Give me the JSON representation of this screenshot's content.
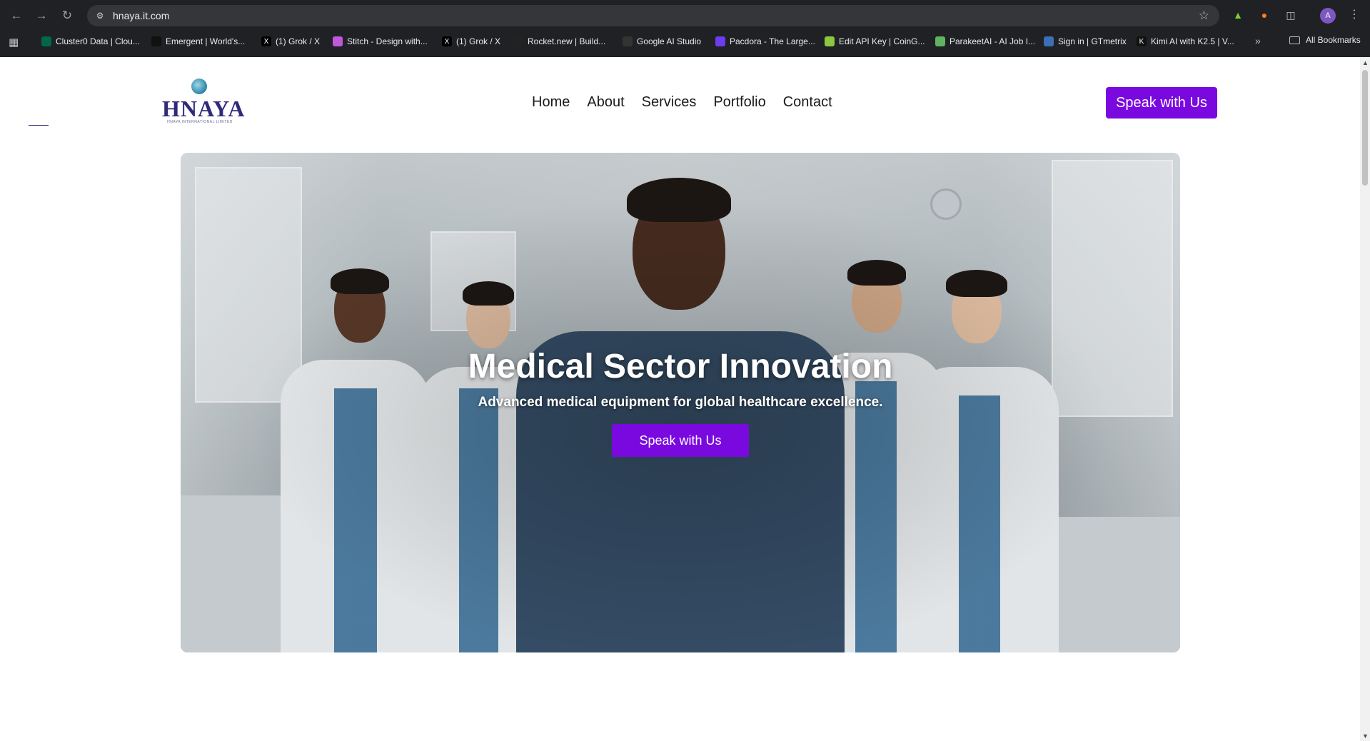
{
  "browser": {
    "url": "hnaya.it.com",
    "avatar_letter": "A",
    "bookmarks": [
      {
        "label": "Cluster0 Data | Clou...",
        "color": "#00684a"
      },
      {
        "label": "Emergent | World's...",
        "color": "#111111"
      },
      {
        "label": "(1) Grok / X",
        "color": "#000000"
      },
      {
        "label": "Stitch - Design with...",
        "color": "#c158dc"
      },
      {
        "label": "(1) Grok / X",
        "color": "#000000"
      },
      {
        "label": "Rocket.new | Build...",
        "color": "#222222"
      },
      {
        "label": "Google AI Studio",
        "color": "#333333"
      },
      {
        "label": "Pacdora - The Large...",
        "color": "#6c3cf0"
      },
      {
        "label": "Edit API Key | CoinG...",
        "color": "#8dc63f"
      },
      {
        "label": "ParakeetAI - AI Job I...",
        "color": "#5fb35f"
      },
      {
        "label": "Sign in | GTmetrix",
        "color": "#3b6fb6"
      },
      {
        "label": "Kimi AI with K2.5 | V...",
        "color": "#111111"
      }
    ],
    "more_glyph": "»",
    "all_bookmarks": "All Bookmarks"
  },
  "site": {
    "logo_text": "HNAYA",
    "logo_sub": "HNAYA INTERNATIONAL LIMITED",
    "nav": [
      "Home",
      "About",
      "Services",
      "Portfolio",
      "Contact"
    ],
    "cta_top": "Speak with Us",
    "accent": "#7a09e0"
  },
  "hero": {
    "title": "Medical Sector Innovation",
    "subtitle": "Advanced medical equipment for global healthcare excellence.",
    "cta": "Speak with Us"
  }
}
